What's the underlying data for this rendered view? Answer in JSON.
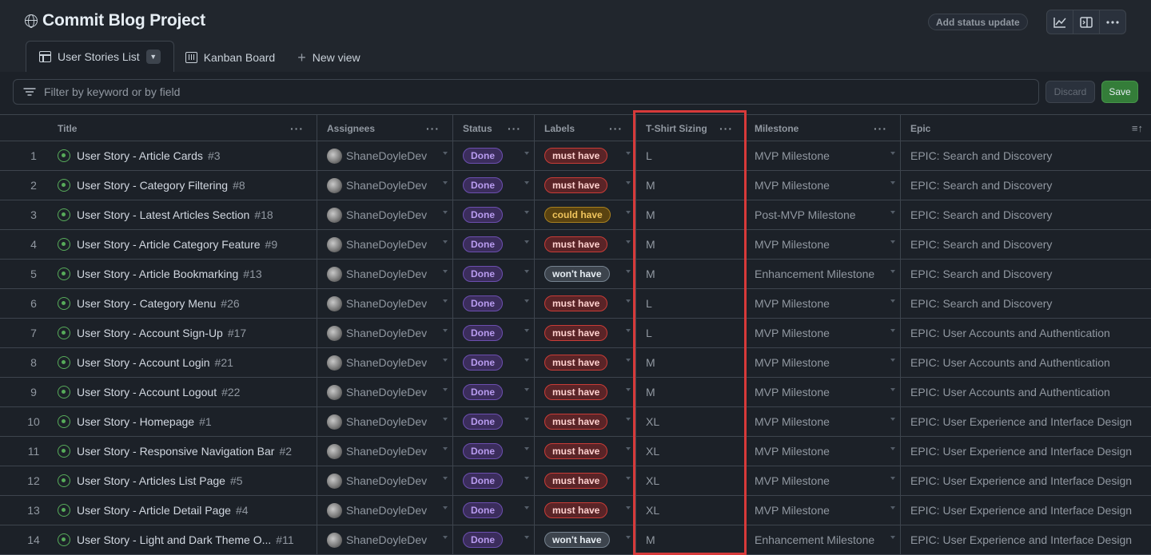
{
  "project": {
    "title": "Commit Blog Project",
    "status_button": "Add status update"
  },
  "toolbar_icons": [
    "insights-icon",
    "side-panel-icon",
    "more-options-icon"
  ],
  "tabs": [
    {
      "label": "User Stories List",
      "active": true
    },
    {
      "label": "Kanban Board",
      "active": false
    },
    {
      "label": "New view",
      "active": false
    }
  ],
  "filter": {
    "placeholder": "Filter by keyword or by field",
    "discard": "Discard",
    "save": "Save"
  },
  "columns": [
    "Title",
    "Assignees",
    "Status",
    "Labels",
    "T-Shirt Sizing",
    "Milestone",
    "Epic"
  ],
  "rows": [
    {
      "n": "1",
      "title": "User Story - Article Cards",
      "issue": "#3",
      "assignee": "ShaneDoyleDev",
      "status": "Done",
      "label": "must have",
      "size": "L",
      "milestone": "MVP Milestone",
      "epic": "EPIC: Search and Discovery"
    },
    {
      "n": "2",
      "title": "User Story - Category Filtering",
      "issue": "#8",
      "assignee": "ShaneDoyleDev",
      "status": "Done",
      "label": "must have",
      "size": "M",
      "milestone": "MVP Milestone",
      "epic": "EPIC: Search and Discovery"
    },
    {
      "n": "3",
      "title": "User Story - Latest Articles Section",
      "issue": "#18",
      "assignee": "ShaneDoyleDev",
      "status": "Done",
      "label": "could have",
      "size": "M",
      "milestone": "Post-MVP Milestone",
      "epic": "EPIC: Search and Discovery"
    },
    {
      "n": "4",
      "title": "User Story - Article Category Feature",
      "issue": "#9",
      "assignee": "ShaneDoyleDev",
      "status": "Done",
      "label": "must have",
      "size": "M",
      "milestone": "MVP Milestone",
      "epic": "EPIC: Search and Discovery"
    },
    {
      "n": "5",
      "title": "User Story - Article Bookmarking",
      "issue": "#13",
      "assignee": "ShaneDoyleDev",
      "status": "Done",
      "label": "won't have",
      "size": "M",
      "milestone": "Enhancement Milestone",
      "epic": "EPIC: Search and Discovery"
    },
    {
      "n": "6",
      "title": "User Story - Category Menu",
      "issue": "#26",
      "assignee": "ShaneDoyleDev",
      "status": "Done",
      "label": "must have",
      "size": "L",
      "milestone": "MVP Milestone",
      "epic": "EPIC: Search and Discovery"
    },
    {
      "n": "7",
      "title": "User Story - Account Sign-Up",
      "issue": "#17",
      "assignee": "ShaneDoyleDev",
      "status": "Done",
      "label": "must have",
      "size": "L",
      "milestone": "MVP Milestone",
      "epic": "EPIC: User Accounts and Authentication"
    },
    {
      "n": "8",
      "title": "User Story - Account Login",
      "issue": "#21",
      "assignee": "ShaneDoyleDev",
      "status": "Done",
      "label": "must have",
      "size": "M",
      "milestone": "MVP Milestone",
      "epic": "EPIC: User Accounts and Authentication"
    },
    {
      "n": "9",
      "title": "User Story - Account Logout",
      "issue": "#22",
      "assignee": "ShaneDoyleDev",
      "status": "Done",
      "label": "must have",
      "size": "M",
      "milestone": "MVP Milestone",
      "epic": "EPIC: User Accounts and Authentication"
    },
    {
      "n": "10",
      "title": "User Story - Homepage",
      "issue": "#1",
      "assignee": "ShaneDoyleDev",
      "status": "Done",
      "label": "must have",
      "size": "XL",
      "milestone": "MVP Milestone",
      "epic": "EPIC: User Experience and Interface Design"
    },
    {
      "n": "11",
      "title": "User Story - Responsive Navigation Bar",
      "issue": "#2",
      "assignee": "ShaneDoyleDev",
      "status": "Done",
      "label": "must have",
      "size": "XL",
      "milestone": "MVP Milestone",
      "epic": "EPIC: User Experience and Interface Design"
    },
    {
      "n": "12",
      "title": "User Story - Articles List Page",
      "issue": "#5",
      "assignee": "ShaneDoyleDev",
      "status": "Done",
      "label": "must have",
      "size": "XL",
      "milestone": "MVP Milestone",
      "epic": "EPIC: User Experience and Interface Design"
    },
    {
      "n": "13",
      "title": "User Story - Article Detail Page",
      "issue": "#4",
      "assignee": "ShaneDoyleDev",
      "status": "Done",
      "label": "must have",
      "size": "XL",
      "milestone": "MVP Milestone",
      "epic": "EPIC: User Experience and Interface Design"
    },
    {
      "n": "14",
      "title": "User Story - Light and Dark Theme O...",
      "issue": "#11",
      "assignee": "ShaneDoyleDev",
      "status": "Done",
      "label": "won't have",
      "size": "M",
      "milestone": "Enhancement Milestone",
      "epic": "EPIC: User Experience and Interface Design"
    }
  ]
}
